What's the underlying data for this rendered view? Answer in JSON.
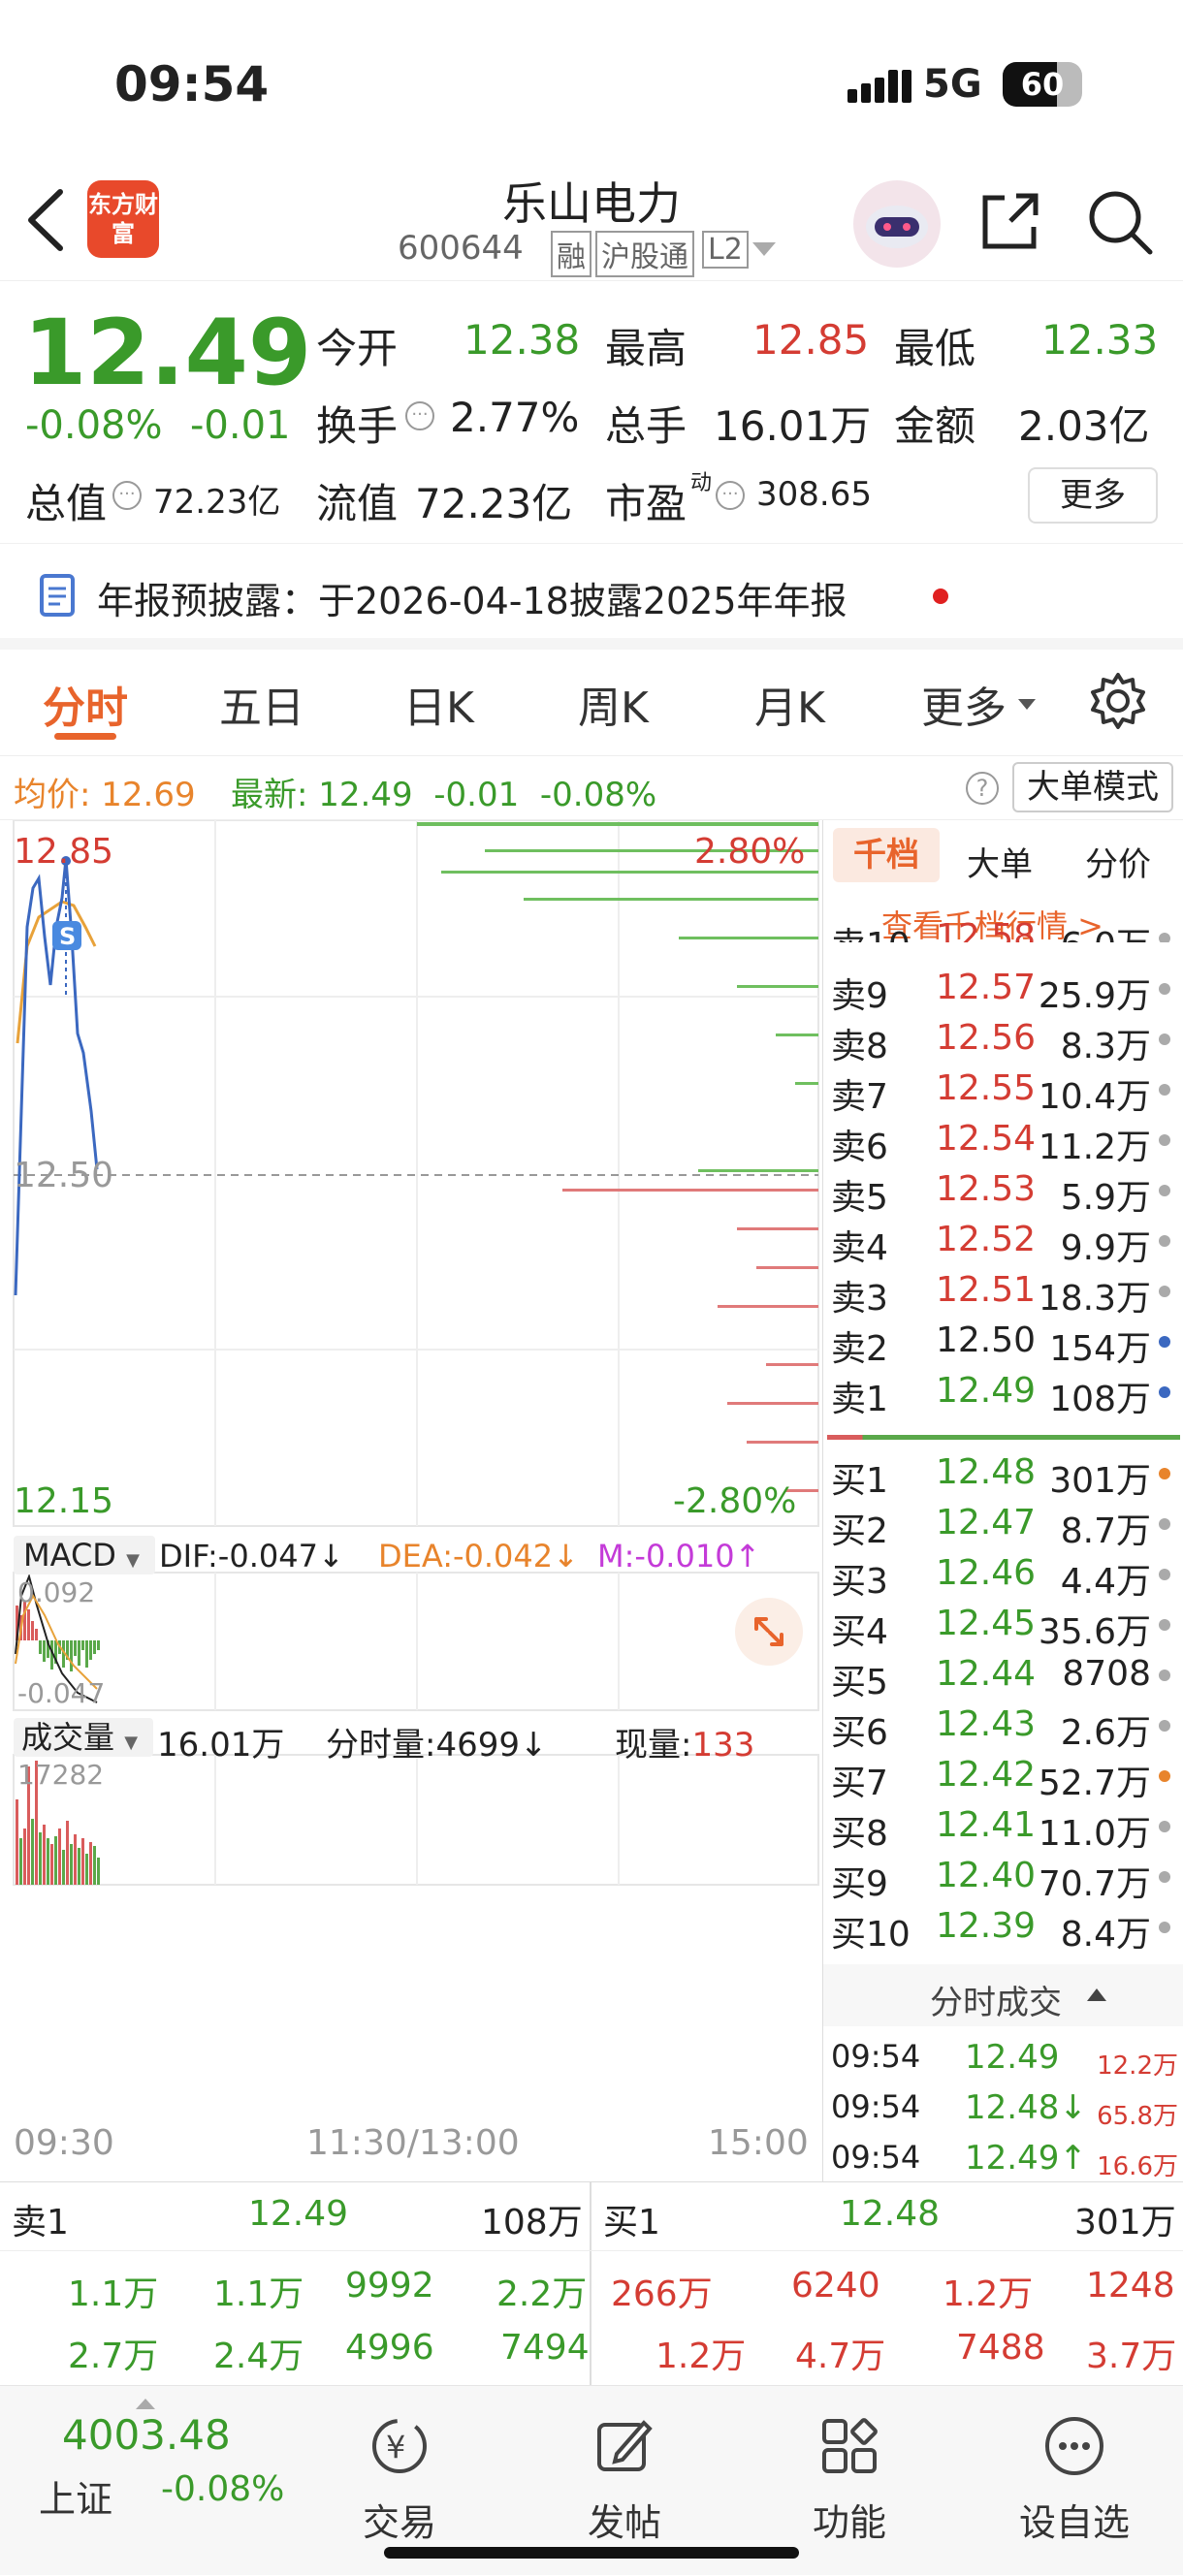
{
  "status_bar": {
    "time": "09:54",
    "network": "5G",
    "battery": "60"
  },
  "header": {
    "stock_name": "乐山电力",
    "stock_code": "600644",
    "badges": [
      "融",
      "沪股通",
      "L2"
    ],
    "logo_text": "东方财富"
  },
  "quote": {
    "price": "12.49",
    "change_pct": "-0.08%",
    "change": "-0.01",
    "open_label": "今开",
    "open": "12.38",
    "high_label": "最高",
    "high": "12.85",
    "low_label": "最低",
    "low": "12.33",
    "turnover_label": "换手",
    "turnover": "2.77%",
    "volume_label": "总手",
    "volume": "16.01万",
    "amount_label": "金额",
    "amount": "2.03亿",
    "mcap_label": "总值",
    "mcap": "72.23亿",
    "float_label": "流值",
    "float_mcap": "72.23亿",
    "pe_label": "市盈",
    "pe_sup": "动",
    "pe": "308.65",
    "more_button": "更多"
  },
  "notice": {
    "text": "年报预披露：于2026-04-18披露2025年年报"
  },
  "tabs": [
    "分时",
    "五日",
    "日K",
    "周K",
    "月K",
    "更多"
  ],
  "avg_line": {
    "avg_label": "均价:",
    "avg": "12.69",
    "latest_label": "最新:",
    "latest": "12.49",
    "change": "-0.01",
    "pct": "-0.08%",
    "mode_button": "大单模式"
  },
  "chart_labels": {
    "top_price": "12.85",
    "top_pct": "2.80%",
    "mid_price": "12.50",
    "bottom_price": "12.15",
    "bottom_pct": "-2.80%"
  },
  "macd": {
    "name": "MACD",
    "dif": "DIF:-0.047↓",
    "dea": "DEA:-0.042↓",
    "m": "M:-0.010↑",
    "top": "0.092",
    "bottom": "-0.047"
  },
  "volume_panel": {
    "name": "成交量",
    "total": "16.01万",
    "minute_label": "分时量:",
    "minute": "4699↓",
    "current_label": "现量:",
    "current": "133",
    "top": "17282"
  },
  "time_axis": {
    "start": "09:30",
    "mid": "11:30/13:00",
    "end": "15:00"
  },
  "book_tabs": {
    "t1": "千档",
    "t2": "大单",
    "t3": "分价",
    "link": "查看千档行情 >"
  },
  "asks": [
    {
      "label": "卖10",
      "price": "12.58",
      "vol": "6.0万"
    },
    {
      "label": "卖9",
      "price": "12.57",
      "vol": "25.9万"
    },
    {
      "label": "卖8",
      "price": "12.56",
      "vol": "8.3万"
    },
    {
      "label": "卖7",
      "price": "12.55",
      "vol": "10.4万"
    },
    {
      "label": "卖6",
      "price": "12.54",
      "vol": "11.2万"
    },
    {
      "label": "卖5",
      "price": "12.53",
      "vol": "5.9万"
    },
    {
      "label": "卖4",
      "price": "12.52",
      "vol": "9.9万"
    },
    {
      "label": "卖3",
      "price": "12.51",
      "vol": "18.3万"
    },
    {
      "label": "卖2",
      "price": "12.50",
      "vol": "154万"
    },
    {
      "label": "卖1",
      "price": "12.49",
      "vol": "108万"
    }
  ],
  "bids": [
    {
      "label": "买1",
      "price": "12.48",
      "vol": "301万"
    },
    {
      "label": "买2",
      "price": "12.47",
      "vol": "8.7万"
    },
    {
      "label": "买3",
      "price": "12.46",
      "vol": "4.4万"
    },
    {
      "label": "买4",
      "price": "12.45",
      "vol": "35.6万"
    },
    {
      "label": "买5",
      "price": "12.44",
      "vol": "8708"
    },
    {
      "label": "买6",
      "price": "12.43",
      "vol": "2.6万"
    },
    {
      "label": "买7",
      "price": "12.42",
      "vol": "52.7万"
    },
    {
      "label": "买8",
      "price": "12.41",
      "vol": "11.0万"
    },
    {
      "label": "买9",
      "price": "12.40",
      "vol": "70.7万"
    },
    {
      "label": "买10",
      "price": "12.39",
      "vol": "8.4万"
    }
  ],
  "trades": {
    "title": "分时成交",
    "rows": [
      {
        "time": "09:54",
        "price": "12.49",
        "vol": "12.2万"
      },
      {
        "time": "09:54",
        "price": "12.48↓",
        "vol": "65.8万"
      },
      {
        "time": "09:54",
        "price": "12.49↑",
        "vol": "16.6万"
      }
    ]
  },
  "summary": {
    "ask1_label": "卖1",
    "ask1_price": "12.49",
    "ask1_vol": "108万",
    "bid1_label": "买1",
    "bid1_price": "12.48",
    "bid1_vol": "301万",
    "ask_row1": [
      "1.1万",
      "1.1万",
      "9992",
      "2.2万"
    ],
    "ask_row2": [
      "2.7万",
      "2.4万",
      "4996",
      "7494"
    ],
    "bid_row1": [
      "266万",
      "6240",
      "1.2万",
      "1248"
    ],
    "bid_row2": [
      "1.2万",
      "4.7万",
      "7488",
      "3.7万"
    ]
  },
  "bottom_nav": {
    "index_value": "4003.48",
    "index_name": "上证",
    "index_pct": "-0.08%",
    "items": [
      "交易",
      "发帖",
      "功能",
      "设自选"
    ]
  }
}
